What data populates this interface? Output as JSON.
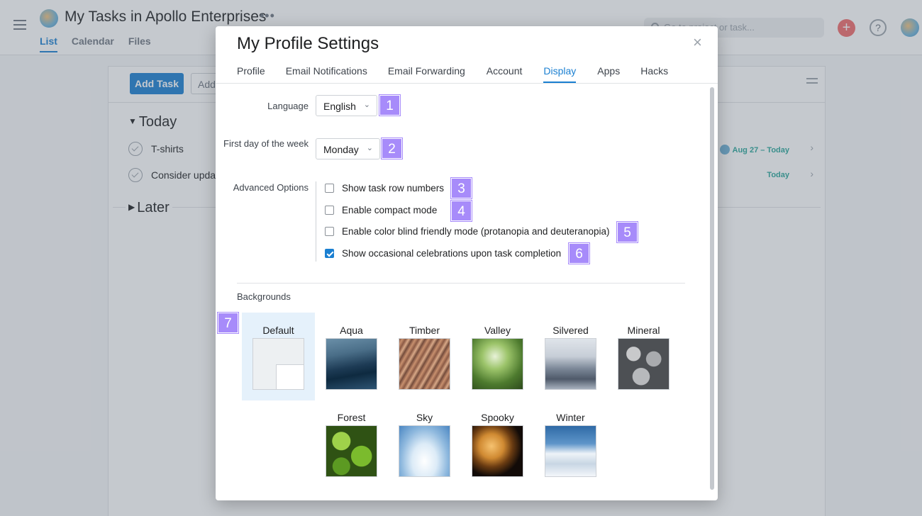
{
  "app": {
    "project_title": "My Tasks in Apollo Enterprises",
    "more_label": "•••",
    "tabs": [
      {
        "label": "List"
      },
      {
        "label": "Calendar"
      },
      {
        "label": "Files"
      }
    ],
    "search_placeholder": "Go to project or task...",
    "add_task_label": "Add Task",
    "add_more_label": "Add",
    "sections": [
      {
        "label": "Today"
      },
      {
        "label": "Later"
      }
    ],
    "tasks": [
      {
        "name": "T-shirts",
        "date": "Aug 27 – Today"
      },
      {
        "name": "Consider updat",
        "date": "Today"
      }
    ]
  },
  "modal": {
    "title": "My Profile Settings",
    "close_label": "×",
    "tabs": [
      {
        "label": "Profile"
      },
      {
        "label": "Email Notifications"
      },
      {
        "label": "Email Forwarding"
      },
      {
        "label": "Account"
      },
      {
        "label": "Display"
      },
      {
        "label": "Apps"
      },
      {
        "label": "Hacks"
      }
    ],
    "active_tab": "Display",
    "language": {
      "label": "Language",
      "value": "English"
    },
    "first_day": {
      "label": "First day of the week",
      "value": "Monday"
    },
    "advanced": {
      "label": "Advanced Options",
      "options": [
        {
          "label": "Show task row numbers",
          "checked": false
        },
        {
          "label": "Enable compact mode",
          "checked": false
        },
        {
          "label": "Enable color blind friendly mode (protanopia and deuteranopia)",
          "checked": false
        },
        {
          "label": "Show occasional celebrations upon task completion",
          "checked": true
        }
      ]
    },
    "backgrounds": {
      "heading": "Backgrounds",
      "selected": "Default",
      "items": [
        {
          "name": "Default"
        },
        {
          "name": "Aqua"
        },
        {
          "name": "Timber"
        },
        {
          "name": "Valley"
        },
        {
          "name": "Silvered"
        },
        {
          "name": "Mineral"
        },
        {
          "name": "Forest"
        },
        {
          "name": "Sky"
        },
        {
          "name": "Spooky"
        },
        {
          "name": "Winter"
        }
      ]
    }
  },
  "badges": [
    "1",
    "2",
    "3",
    "4",
    "5",
    "6",
    "7"
  ],
  "colors": {
    "accent": "#1a7fd1",
    "badge": "#a78bfa",
    "plus_button": "#f06a6a"
  }
}
